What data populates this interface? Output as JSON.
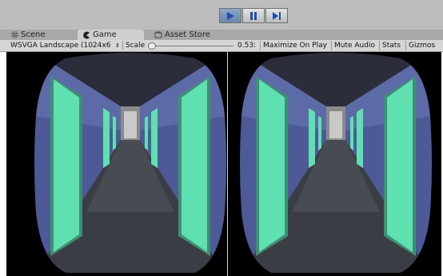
{
  "controls": {
    "play": "play-icon",
    "pause": "pause-icon",
    "step": "step-icon"
  },
  "tabs": [
    {
      "label": "Scene",
      "icon": "scene-grid-icon"
    },
    {
      "label": "Game",
      "icon": "game-pacman-icon"
    },
    {
      "label": "Asset Store",
      "icon": "asset-store-icon"
    }
  ],
  "gamebar": {
    "resolution": "WSVGA Landscape (1024x6",
    "scale_label": "Scale",
    "scale_value": "0.53:",
    "scale_level": 0.0,
    "maximize": "Maximize On Play",
    "mute": "Mute Audio",
    "stats": "Stats",
    "gizmos": "Gizmos"
  },
  "colors": {
    "toolbar": "#bdbdbd",
    "play_active": "#7893b6",
    "icon_blue": "#1f4fa8",
    "door": "#5fe0b0",
    "wall": "#4d5a97",
    "floor": "#3a3e44"
  }
}
